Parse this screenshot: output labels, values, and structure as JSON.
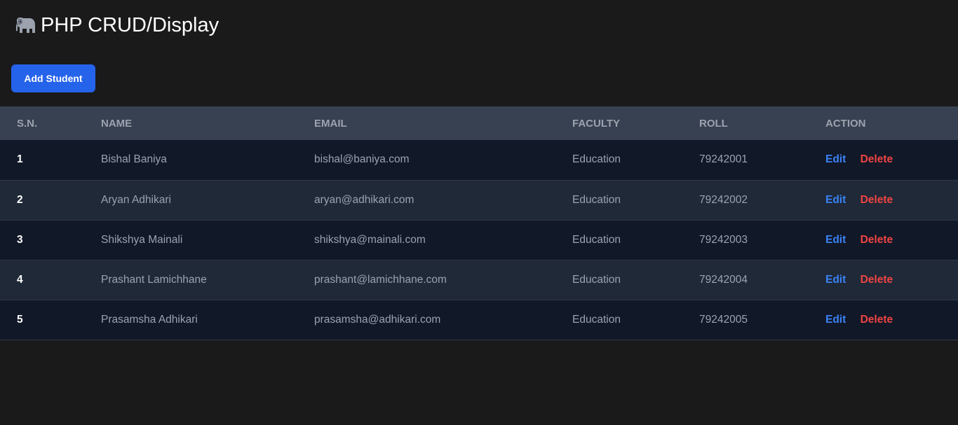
{
  "header": {
    "title": "PHP CRUD/Display"
  },
  "toolbar": {
    "add_label": "Add Student"
  },
  "table": {
    "columns": [
      "S.N.",
      "NAME",
      "EMAIL",
      "FACULTY",
      "ROLL",
      "ACTION"
    ],
    "rows": [
      {
        "sn": "1",
        "name": "Bishal Baniya",
        "email": "bishal@baniya.com",
        "faculty": "Education",
        "roll": "79242001",
        "edit": "Edit",
        "delete": "Delete"
      },
      {
        "sn": "2",
        "name": "Aryan Adhikari",
        "email": "aryan@adhikari.com",
        "faculty": "Education",
        "roll": "79242002",
        "edit": "Edit",
        "delete": "Delete"
      },
      {
        "sn": "3",
        "name": "Shikshya Mainali",
        "email": "shikshya@mainali.com",
        "faculty": "Education",
        "roll": "79242003",
        "edit": "Edit",
        "delete": "Delete"
      },
      {
        "sn": "4",
        "name": "Prashant Lamichhane",
        "email": "prashant@lamichhane.com",
        "faculty": "Education",
        "roll": "79242004",
        "edit": "Edit",
        "delete": "Delete"
      },
      {
        "sn": "5",
        "name": "Prasamsha Adhikari",
        "email": "prasamsha@adhikari.com",
        "faculty": "Education",
        "roll": "79242005",
        "edit": "Edit",
        "delete": "Delete"
      }
    ]
  },
  "icons": {
    "logo": "elephant-icon"
  },
  "colors": {
    "background": "#1a1a1b",
    "primary_button": "#2563eb",
    "header_row": "#374151",
    "row_odd": "#111827",
    "row_even": "#1f2937",
    "edit_link": "#3b82f6",
    "delete_link": "#ef4444"
  }
}
